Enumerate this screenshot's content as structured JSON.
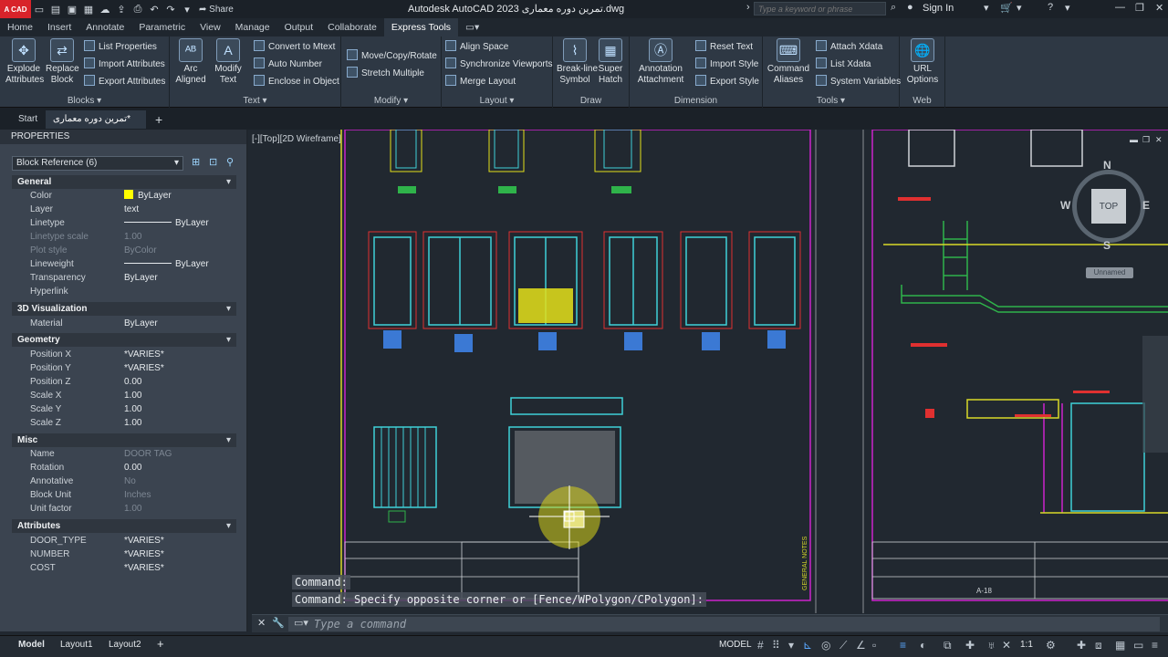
{
  "window": {
    "logo": "A CAD",
    "share": "Share",
    "title": "Autodesk AutoCAD 2023",
    "doc_name": "تمرین دوره معماری.dwg",
    "search_placeholder": "Type a keyword or phrase",
    "sign_in": "Sign In"
  },
  "ribbon_tabs": [
    "Home",
    "Insert",
    "Annotate",
    "Parametric",
    "View",
    "Manage",
    "Output",
    "Collaborate",
    "Express Tools"
  ],
  "ribbon": {
    "blocks": {
      "title": "Blocks",
      "explode": "Explode\nAttributes",
      "replace": "Replace\nBlock",
      "list_props": "List Properties",
      "import_attr": "Import Attributes",
      "export_attr": "Export Attributes"
    },
    "text": {
      "title": "Text",
      "arc": "Arc\nAligned",
      "modify": "Modify\nText",
      "convert": "Convert to Mtext",
      "auto_number": "Auto Number",
      "enclose": "Enclose in Object"
    },
    "modify": {
      "title": "Modify",
      "move": "Move/Copy/Rotate",
      "stretch": "Stretch Multiple"
    },
    "layout": {
      "title": "Layout",
      "align": "Align Space",
      "sync": "Synchronize Viewports",
      "merge": "Merge Layout"
    },
    "draw": {
      "title": "Draw",
      "breakline": "Break-line\nSymbol",
      "superhatch": "Super\nHatch"
    },
    "dimension": {
      "title": "Dimension",
      "annotation": "Annotation\nAttachment",
      "reset": "Reset Text",
      "import_style": "Import Style",
      "export_style": "Export Style"
    },
    "tools": {
      "title": "Tools",
      "command_aliases": "Command\nAliases",
      "attach": "Attach Xdata",
      "list": "List Xdata",
      "sysvar": "System Variables"
    },
    "web": {
      "title": "Web",
      "url": "URL\nOptions"
    }
  },
  "doc_tabs": {
    "start": "Start",
    "current": "تمرین دوره معماری*"
  },
  "properties": {
    "header": "PROPERTIES",
    "selection": "Block Reference (6)",
    "sections": {
      "general": "General",
      "viz": "3D Visualization",
      "geometry": "Geometry",
      "misc": "Misc",
      "attributes": "Attributes"
    },
    "general": [
      {
        "k": "Color",
        "v": "ByLayer"
      },
      {
        "k": "Layer",
        "v": "text"
      },
      {
        "k": "Linetype",
        "v": "ByLayer"
      },
      {
        "k": "Linetype scale",
        "v": "1.00"
      },
      {
        "k": "Plot style",
        "v": "ByColor"
      },
      {
        "k": "Lineweight",
        "v": "ByLayer"
      },
      {
        "k": "Transparency",
        "v": "ByLayer"
      },
      {
        "k": "Hyperlink",
        "v": ""
      }
    ],
    "viz": [
      {
        "k": "Material",
        "v": "ByLayer"
      }
    ],
    "geometry": [
      {
        "k": "Position X",
        "v": "*VARIES*"
      },
      {
        "k": "Position Y",
        "v": "*VARIES*"
      },
      {
        "k": "Position Z",
        "v": "0.00"
      },
      {
        "k": "Scale X",
        "v": "1.00"
      },
      {
        "k": "Scale Y",
        "v": "1.00"
      },
      {
        "k": "Scale Z",
        "v": "1.00"
      }
    ],
    "misc": [
      {
        "k": "Name",
        "v": "DOOR TAG"
      },
      {
        "k": "Rotation",
        "v": "0.00"
      },
      {
        "k": "Annotative",
        "v": "No"
      },
      {
        "k": "Block Unit",
        "v": "Inches"
      },
      {
        "k": "Unit factor",
        "v": "1.00"
      }
    ],
    "attributes": [
      {
        "k": "DOOR_TYPE",
        "v": "*VARIES*"
      },
      {
        "k": "NUMBER",
        "v": "*VARIES*"
      },
      {
        "k": "COST",
        "v": "*VARIES*"
      }
    ]
  },
  "viewport": {
    "label": "[-][Top][2D Wireframe]",
    "compass": {
      "n": "N",
      "s": "S",
      "e": "E",
      "w": "W",
      "top": "TOP"
    },
    "ucs_name": "Unnamed",
    "title_block_text": "GENERAL NOTES",
    "sheet_no": "A-18"
  },
  "command": {
    "history": [
      "Command:",
      "Command: Specify opposite corner or [Fence/WPolygon/CPolygon]:"
    ],
    "placeholder": "Type a command"
  },
  "status": {
    "layouts": [
      "Model",
      "Layout1",
      "Layout2"
    ],
    "mode": "MODEL",
    "scale": "1:1"
  },
  "colors": {
    "accent": "#2e3844",
    "cad_cyan": "#3fd1d8",
    "cad_yellow": "#e4e11a",
    "cad_magenta": "#cc22cc"
  }
}
